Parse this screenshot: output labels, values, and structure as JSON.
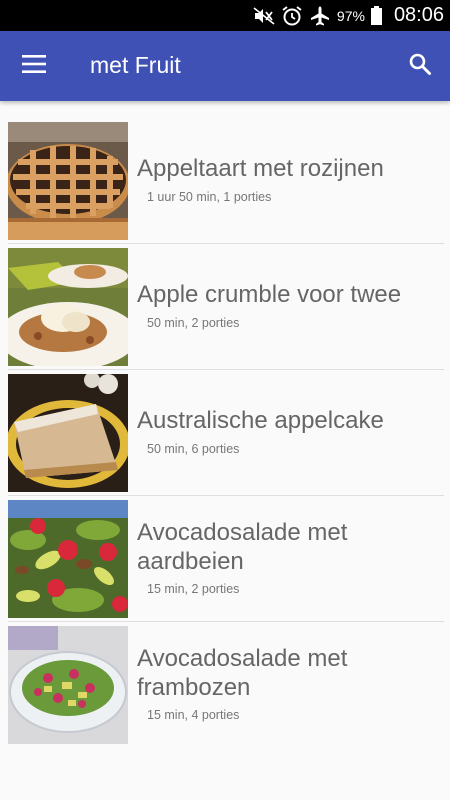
{
  "status_bar": {
    "battery_percent": "97%",
    "time": "08:06",
    "icons": [
      "mute-icon",
      "alarm-icon",
      "airplane-mode-icon",
      "battery-icon"
    ]
  },
  "app_bar": {
    "title": "met Fruit",
    "menu_icon": "hamburger-menu-icon",
    "search_icon": "search-icon",
    "color": "#3f51b5"
  },
  "recipes": [
    {
      "title": "Appeltaart met rozijnen",
      "meta": "1 uur 50 min, 1 porties"
    },
    {
      "title": "Apple crumble voor twee",
      "meta": "50 min, 2 porties"
    },
    {
      "title": "Australische appelcake",
      "meta": "50 min, 6 porties"
    },
    {
      "title": "Avocadosalade met aardbeien",
      "meta": "15 min, 2 porties"
    },
    {
      "title": "Avocadosalade met frambozen",
      "meta": "15 min, 4 porties"
    }
  ]
}
